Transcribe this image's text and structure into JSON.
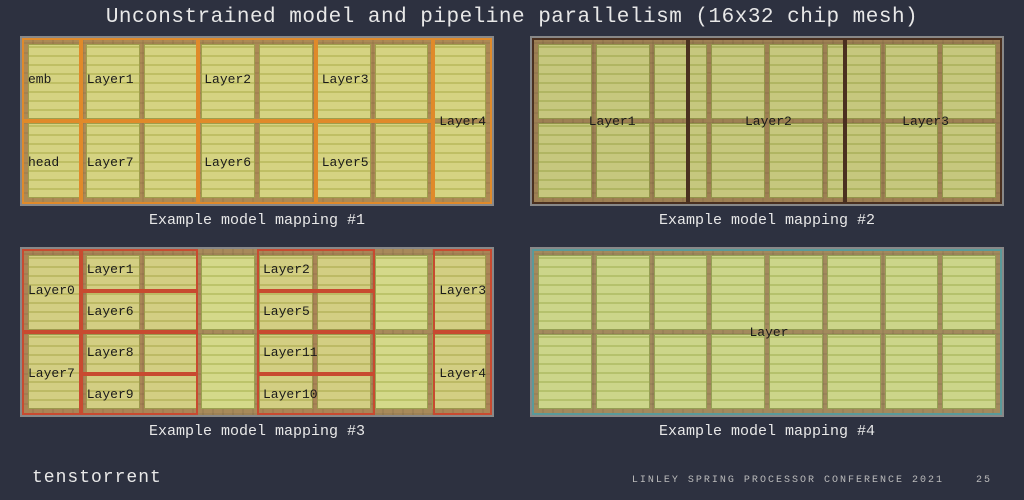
{
  "title": "Unconstrained model and pipeline parallelism (16x32 chip mesh)",
  "footer": {
    "left": "tenstorrent",
    "right": "LINLEY SPRING PROCESSOR CONFERENCE 2021",
    "page": "25"
  },
  "mesh": {
    "cols": 8,
    "rows": 2
  },
  "panels": [
    {
      "caption": "Example model mapping #1",
      "color": "orange",
      "regions": [
        {
          "label": "emb",
          "col": 0,
          "row": 0,
          "w": 1,
          "h": 1
        },
        {
          "label": "Layer1",
          "col": 1,
          "row": 0,
          "w": 2,
          "h": 1
        },
        {
          "label": "Layer2",
          "col": 3,
          "row": 0,
          "w": 2,
          "h": 1
        },
        {
          "label": "Layer3",
          "col": 5,
          "row": 0,
          "w": 2,
          "h": 1
        },
        {
          "label": "Layer4",
          "col": 7,
          "row": 0,
          "w": 1,
          "h": 2
        },
        {
          "label": "head",
          "col": 0,
          "row": 1,
          "w": 1,
          "h": 1
        },
        {
          "label": "Layer7",
          "col": 1,
          "row": 1,
          "w": 2,
          "h": 1
        },
        {
          "label": "Layer6",
          "col": 3,
          "row": 1,
          "w": 2,
          "h": 1
        },
        {
          "label": "Layer5",
          "col": 5,
          "row": 1,
          "w": 2,
          "h": 1
        }
      ]
    },
    {
      "caption": "Example model mapping #2",
      "color": "dark",
      "regions": [
        {
          "label": "Layer1",
          "col": 0,
          "row": 0,
          "w": 2.66,
          "h": 2,
          "center": true
        },
        {
          "label": "Layer2",
          "col": 2.66,
          "row": 0,
          "w": 2.66,
          "h": 2,
          "center": true
        },
        {
          "label": "Layer3",
          "col": 5.33,
          "row": 0,
          "w": 2.67,
          "h": 2,
          "center": true
        }
      ]
    },
    {
      "caption": "Example model mapping #3",
      "color": "red",
      "regions": [
        {
          "label": "Layer0",
          "col": 0,
          "row": 0,
          "w": 1,
          "h": 1
        },
        {
          "label": "Layer1",
          "col": 1,
          "row": 0,
          "w": 2,
          "h": 0.5
        },
        {
          "label": "Layer6",
          "col": 1,
          "row": 0.5,
          "w": 2,
          "h": 0.5
        },
        {
          "label": "Layer2",
          "col": 4,
          "row": 0,
          "w": 2,
          "h": 0.5
        },
        {
          "label": "Layer5",
          "col": 4,
          "row": 0.5,
          "w": 2,
          "h": 0.5
        },
        {
          "label": "Layer3",
          "col": 7,
          "row": 0,
          "w": 1,
          "h": 1
        },
        {
          "label": "Layer7",
          "col": 0,
          "row": 1,
          "w": 1,
          "h": 1
        },
        {
          "label": "Layer8",
          "col": 1,
          "row": 1,
          "w": 2,
          "h": 0.5
        },
        {
          "label": "Layer9",
          "col": 1,
          "row": 1.5,
          "w": 2,
          "h": 0.5
        },
        {
          "label": "Layer11",
          "col": 4,
          "row": 1,
          "w": 2,
          "h": 0.5
        },
        {
          "label": "Layer10",
          "col": 4,
          "row": 1.5,
          "w": 2,
          "h": 0.5
        },
        {
          "label": "Layer4",
          "col": 7,
          "row": 1,
          "w": 1,
          "h": 1
        }
      ]
    },
    {
      "caption": "Example model mapping #4",
      "color": "teal",
      "regions": [
        {
          "label": "Layer",
          "col": 0,
          "row": 0,
          "w": 8,
          "h": 2,
          "center": true
        }
      ]
    }
  ]
}
